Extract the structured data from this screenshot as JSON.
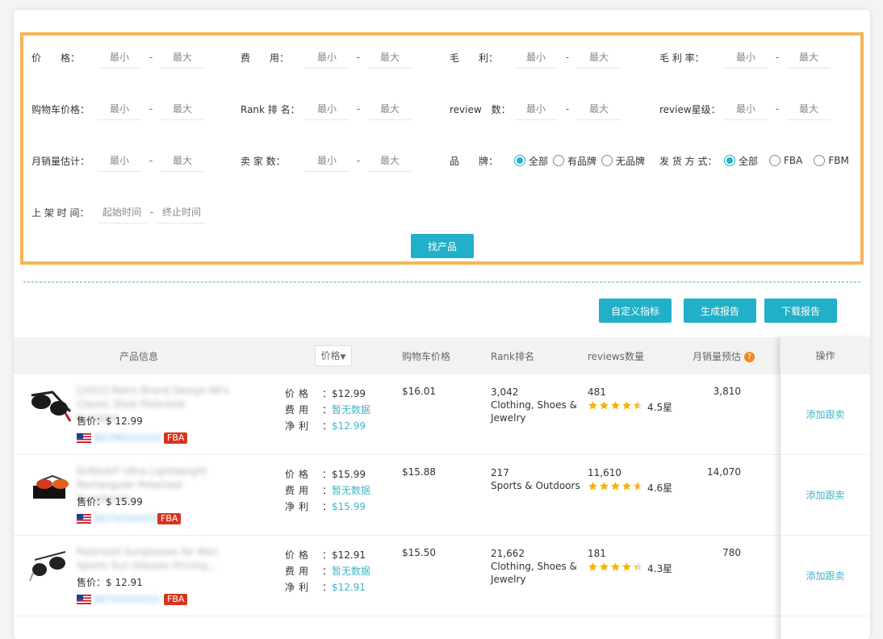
{
  "filters": {
    "price_label": "价　　格：",
    "fee_label": "费　　用：",
    "profit_label": "毛　　利：",
    "margin_label": "毛 利 率：",
    "cart_price_label": "购物车价格：",
    "rank_label": "Rank 排 名：",
    "review_label": "review　数：",
    "review_star_label": "review星级：",
    "monthly_sales_label": "月销量估计：",
    "sellers_label": "卖 家 数：",
    "brand_label": "品　　牌：",
    "shipping_label": "发 货 方 式：",
    "listed_label": "上 架 时 间：",
    "min_placeholder": "最小",
    "max_placeholder": "最大",
    "start_placeholder": "起始时间",
    "end_placeholder": "终止时间",
    "brand_options": [
      "全部",
      "有品牌",
      "无品牌"
    ],
    "shipping_options": [
      "全部",
      "FBA",
      "FBM"
    ],
    "find_button": "找产品"
  },
  "actions": {
    "custom": "自定义指标",
    "report": "生成报告",
    "download": "下载报告"
  },
  "table": {
    "headers": {
      "product": "产品信息",
      "price": "价格",
      "cart": "购物车价格",
      "rank": "Rank排名",
      "reviews": "reviews数量",
      "monthly": "月销量预估",
      "op": "操作"
    },
    "row_labels": {
      "price": "价格",
      "fee": "费用",
      "net": "净利",
      "sale_prefix": "售价："
    },
    "rows": [
      {
        "title": "[2022] Retro Brand Design 80's Classic Style Polarized Sunglass...",
        "sale": "$ 12.99",
        "asin": "B07MXXXXXX",
        "fulfil": "FBA",
        "price": "$12.99",
        "fee": "暂无数据",
        "net": "$12.99",
        "cart": "$16.01",
        "rank": "3,042",
        "category": "Clothing, Shoes & Jewelry",
        "reviews": "481",
        "rating": 4.5,
        "rating_text": "4.5星",
        "monthly": "3,810",
        "op": "添加跟卖"
      },
      {
        "title": "SUNGAIT Ultra Lightweight Rectangular Polarized Sunglasses .",
        "sale": "$ 15.99",
        "asin": "B07XXXXXXX",
        "fulfil": "FBA",
        "price": "$15.99",
        "fee": "暂无数据",
        "net": "$15.99",
        "cart": "$15.88",
        "rank": "217",
        "category": "Sports & Outdoors",
        "reviews": "11,610",
        "rating": 4.6,
        "rating_text": "4.6星",
        "monthly": "14,070",
        "op": "添加跟卖"
      },
      {
        "title": "Polarized Sunglasses for Men Sports Sun Glasses Driving...",
        "sale": "$ 12.91",
        "asin": "B07XXXXXXX",
        "fulfil": "FBA",
        "price": "$12.91",
        "fee": "暂无数据",
        "net": "$12.91",
        "cart": "$15.50",
        "rank": "21,662",
        "category": "Clothing, Shoes & Jewelry",
        "reviews": "181",
        "rating": 4.3,
        "rating_text": "4.3星",
        "monthly": "780",
        "op": "添加跟卖"
      }
    ]
  },
  "colors": {
    "accent": "#21b0c8",
    "border": "#f6b556",
    "fba": "#d8331f",
    "star": "#f5b301"
  }
}
